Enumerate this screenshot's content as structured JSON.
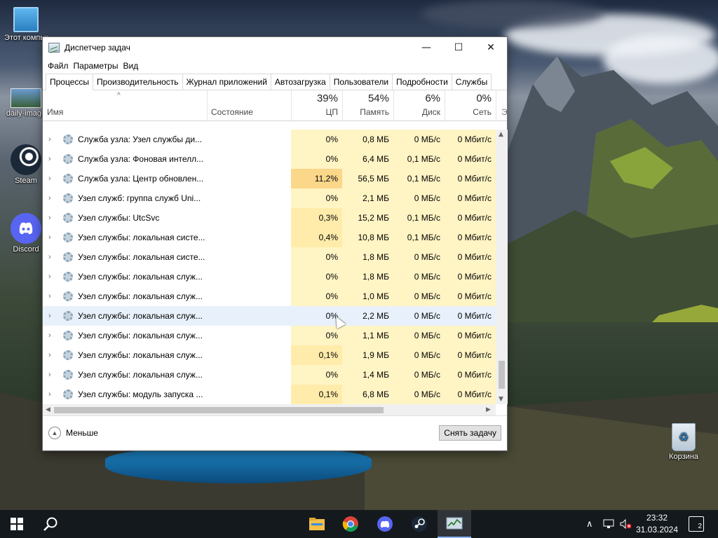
{
  "window": {
    "title": "Диспетчер задач",
    "controls": {
      "minimize": "—",
      "maximize": "☐",
      "close": "✕"
    }
  },
  "menu": [
    "Файл",
    "Параметры",
    "Вид"
  ],
  "tabs": [
    "Процессы",
    "Производительность",
    "Журнал приложений",
    "Автозагрузка",
    "Пользователи",
    "Подробности",
    "Службы"
  ],
  "active_tab": 0,
  "columns": {
    "name": "Имя",
    "state": "Состояние",
    "cpu": {
      "percent": "39%",
      "label": "ЦП"
    },
    "memory": {
      "percent": "54%",
      "label": "Память"
    },
    "disk": {
      "percent": "6%",
      "label": "Диск"
    },
    "network": {
      "percent": "0%",
      "label": "Сеть"
    },
    "extra": "Э"
  },
  "rows": [
    {
      "name": "Служба узла: Узел службы ди...",
      "cpu": "0%",
      "memory": "0,8 МБ",
      "disk": "0 МБ/с",
      "network": "0 Мбит/с",
      "heat": 0
    },
    {
      "name": "Служба узла: Фоновая интелл...",
      "cpu": "0%",
      "memory": "6,4 МБ",
      "disk": "0,1 МБ/с",
      "network": "0 Мбит/с",
      "heat": 0
    },
    {
      "name": "Служба узла: Центр обновлен...",
      "cpu": "11,2%",
      "memory": "56,5 МБ",
      "disk": "0,1 МБ/с",
      "network": "0 Мбит/с",
      "heat": 2
    },
    {
      "name": "Узел служб: группа служб Uni...",
      "cpu": "0%",
      "memory": "2,1 МБ",
      "disk": "0 МБ/с",
      "network": "0 Мбит/с",
      "heat": 0
    },
    {
      "name": "Узел службы: UtcSvc",
      "cpu": "0,3%",
      "memory": "15,2 МБ",
      "disk": "0,1 МБ/с",
      "network": "0 Мбит/с",
      "heat": 1
    },
    {
      "name": "Узел службы: локальная систе...",
      "cpu": "0,4%",
      "memory": "10,8 МБ",
      "disk": "0,1 МБ/с",
      "network": "0 Мбит/с",
      "heat": 1
    },
    {
      "name": "Узел службы: локальная систе...",
      "cpu": "0%",
      "memory": "1,8 МБ",
      "disk": "0 МБ/с",
      "network": "0 Мбит/с",
      "heat": 0
    },
    {
      "name": "Узел службы: локальная служ...",
      "cpu": "0%",
      "memory": "1,8 МБ",
      "disk": "0 МБ/с",
      "network": "0 Мбит/с",
      "heat": 0
    },
    {
      "name": "Узел службы: локальная служ...",
      "cpu": "0%",
      "memory": "1,0 МБ",
      "disk": "0 МБ/с",
      "network": "0 Мбит/с",
      "heat": 0
    },
    {
      "name": "Узел службы: локальная служ...",
      "cpu": "0%",
      "memory": "2,2 МБ",
      "disk": "0 МБ/с",
      "network": "0 Мбит/с",
      "heat": 0,
      "hover": true
    },
    {
      "name": "Узел службы: локальная служ...",
      "cpu": "0%",
      "memory": "1,1 МБ",
      "disk": "0 МБ/с",
      "network": "0 Мбит/с",
      "heat": 0
    },
    {
      "name": "Узел службы: локальная служ...",
      "cpu": "0,1%",
      "memory": "1,9 МБ",
      "disk": "0 МБ/с",
      "network": "0 Мбит/с",
      "heat": 1
    },
    {
      "name": "Узел службы: локальная служ...",
      "cpu": "0%",
      "memory": "1,4 МБ",
      "disk": "0 МБ/с",
      "network": "0 Мбит/с",
      "heat": 0
    },
    {
      "name": "Узел службы: модуль запуска ...",
      "cpu": "0,1%",
      "memory": "6,8 МБ",
      "disk": "0 МБ/с",
      "network": "0 Мбит/с",
      "heat": 1
    }
  ],
  "footer": {
    "less": "Меньше",
    "end_task": "Снять задачу"
  },
  "desktop_icons": [
    {
      "label": "Этот компьютер",
      "icon": "computer-icon"
    },
    {
      "label": "daily-image",
      "icon": "image-file-icon"
    },
    {
      "label": "Steam",
      "icon": "steam-icon"
    },
    {
      "label": "Discord",
      "icon": "discord-icon"
    },
    {
      "label": "Корзина",
      "icon": "recycle-bin-icon"
    }
  ],
  "taskbar": {
    "apps": [
      "file-explorer-icon",
      "chrome-icon",
      "discord-icon",
      "steam-icon",
      "task-manager-icon"
    ],
    "time": "23:32",
    "date": "31.03.2024",
    "notifications": "2"
  },
  "colors": {
    "heat0": "#fff4c4",
    "heat1": "#ffecaa",
    "heat2": "#fbd78a",
    "hover": "#e8f1fb",
    "taskbar": "#14181e"
  }
}
